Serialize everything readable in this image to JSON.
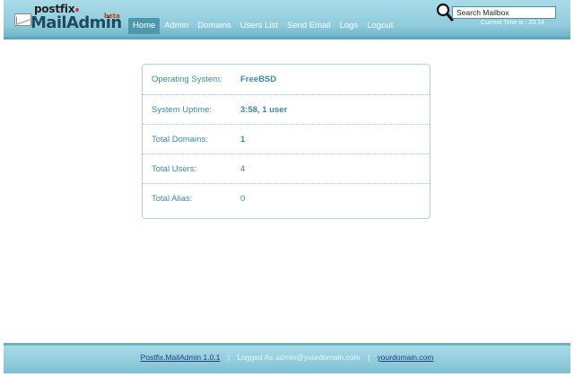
{
  "header": {
    "logo": {
      "top_text": "postfix",
      "main_text": "MailAdmin",
      "badge": "beta"
    },
    "nav": [
      {
        "label": "Home",
        "active": true
      },
      {
        "label": "Admin",
        "active": false
      },
      {
        "label": "Domains",
        "active": false
      },
      {
        "label": "Users List",
        "active": false
      },
      {
        "label": "Send Email",
        "active": false
      },
      {
        "label": "Logs",
        "active": false
      },
      {
        "label": "Logout",
        "active": false
      }
    ],
    "search": {
      "placeholder": "Search Mailbox",
      "value": "Search Mailbox",
      "icon": "magnifier-icon"
    },
    "current_time": {
      "label": "Current Time is :",
      "value": "20.14"
    }
  },
  "info": [
    {
      "label": "Operating System:",
      "value": "FreeBSD"
    },
    {
      "label": "System Uptime:",
      "value": "3:58, 1 user"
    },
    {
      "label": "Total Domains:",
      "value": "1"
    },
    {
      "label": "Total Users:",
      "value": "4"
    },
    {
      "label": "Total Alias:",
      "value": "0"
    }
  ],
  "footer": {
    "product_link": "Postfix.MailAdmin 1.0.1",
    "divider": "|",
    "logged_as": "Logged As admin@yourdomain.com",
    "domain_link": "yourdomain.com"
  },
  "colors": {
    "header_top": "#a9dbe8",
    "header_bottom": "#6fb4c7",
    "nav_active": "#4f97ab",
    "text_accent": "#3a8aa0",
    "panel_border": "#a8d4e0",
    "link": "#1f3f7a"
  }
}
